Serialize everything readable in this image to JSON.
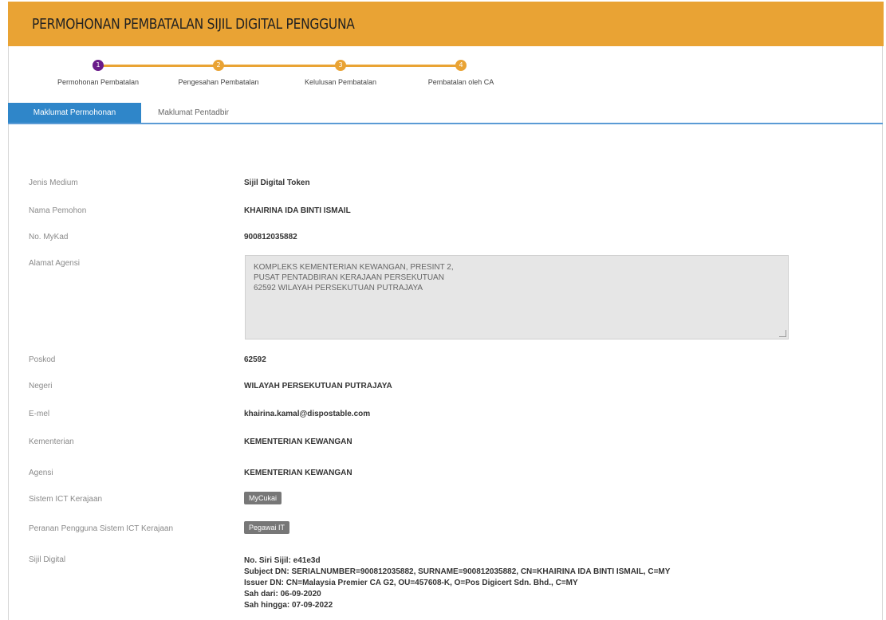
{
  "header": {
    "title": "PERMOHONAN PEMBATALAN SIJIL DIGITAL PENGGUNA"
  },
  "steps": [
    {
      "number": "1",
      "label": "Permohonan Pembatalan"
    },
    {
      "number": "2",
      "label": "Pengesahan Pembatalan"
    },
    {
      "number": "3",
      "label": "Kelulusan Pembatalan"
    },
    {
      "number": "4",
      "label": "Pembatalan oleh CA"
    }
  ],
  "tabs": [
    {
      "label": "Maklumat Permohonan"
    },
    {
      "label": "Maklumat Pentadbir"
    }
  ],
  "form": {
    "jenis_medium": {
      "label": "Jenis Medium",
      "value": "Sijil Digital Token"
    },
    "nama_pemohon": {
      "label": "Nama Pemohon",
      "value": "KHAIRINA IDA BINTI ISMAIL"
    },
    "mykad": {
      "label": "No. MyKad",
      "value": "900812035882"
    },
    "alamat": {
      "label": "Alamat Agensi",
      "lines": [
        "KOMPLEKS KEMENTERIAN KEWANGAN, PRESINT 2,",
        "PUSAT PENTADBIRAN KERAJAAN PERSEKUTUAN",
        "62592 WILAYAH PERSEKUTUAN PUTRAJAYA"
      ]
    },
    "poskod": {
      "label": "Poskod",
      "value": "62592"
    },
    "negeri": {
      "label": "Negeri",
      "value": "WILAYAH PERSEKUTUAN PUTRAJAYA"
    },
    "emel": {
      "label": "E-mel",
      "value": "khairina.kamal@dispostable.com"
    },
    "kementerian": {
      "label": "Kementerian",
      "value": "KEMENTERIAN KEWANGAN"
    },
    "agensi": {
      "label": "Agensi",
      "value": "KEMENTERIAN KEWANGAN"
    },
    "sistem_ict": {
      "label": "Sistem ICT Kerajaan",
      "badge": "MyCukai"
    },
    "peranan": {
      "label": "Peranan Pengguna Sistem ICT Kerajaan",
      "badge": "Pegawai IT"
    },
    "sijil": {
      "label": "Sijil Digital",
      "lines": [
        "No. Siri Sijil: e41e3d",
        "Subject DN: SERIALNUMBER=900812035882, SURNAME=900812035882, CN=KHAIRINA IDA BINTI ISMAIL, C=MY",
        "Issuer DN: CN=Malaysia Premier CA G2, OU=457608-K, O=Pos Digicert Sdn. Bhd., C=MY",
        "Sah dari: 06-09-2020",
        "Sah hingga: 07-09-2022"
      ]
    }
  },
  "colors": {
    "header": "#e9a334",
    "active_step": "#6a1b8a",
    "active_tab": "#2f86c9",
    "badge": "#777777"
  }
}
